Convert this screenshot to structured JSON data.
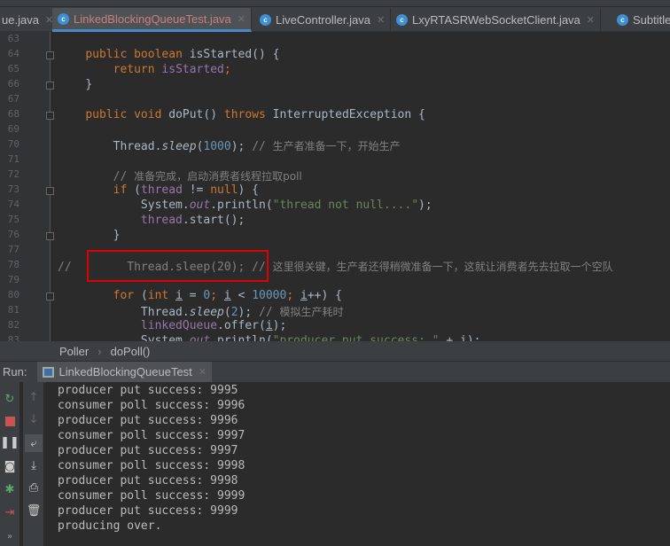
{
  "tabs": [
    {
      "label": "ue.java",
      "active": false
    },
    {
      "label": "LinkedBlockingQueueTest.java",
      "active": true
    },
    {
      "label": "LiveController.java",
      "active": false
    },
    {
      "label": "LxyRTASRWebSocketClient.java",
      "active": false
    },
    {
      "label": "SubtitleUti",
      "active": false
    }
  ],
  "editor": {
    "lines": [
      {
        "num": "63",
        "indent": "",
        "tokens": []
      },
      {
        "num": "64",
        "indent": "    ",
        "tokens": [
          {
            "t": "public ",
            "c": "kw"
          },
          {
            "t": "boolean ",
            "c": "kw"
          },
          {
            "t": "isStarted() {",
            "c": ""
          }
        ]
      },
      {
        "num": "65",
        "indent": "        ",
        "tokens": [
          {
            "t": "return ",
            "c": "kw"
          },
          {
            "t": "isStarted",
            "c": "fld"
          },
          {
            "t": ";",
            "c": "kw"
          }
        ]
      },
      {
        "num": "66",
        "indent": "    ",
        "tokens": [
          {
            "t": "}",
            "c": ""
          }
        ]
      },
      {
        "num": "67",
        "indent": "",
        "tokens": []
      },
      {
        "num": "68",
        "indent": "    ",
        "tokens": [
          {
            "t": "public ",
            "c": "kw"
          },
          {
            "t": "void ",
            "c": "kw"
          },
          {
            "t": "doPut() ",
            "c": ""
          },
          {
            "t": "throws ",
            "c": "kw"
          },
          {
            "t": "InterruptedException {",
            "c": ""
          }
        ]
      },
      {
        "num": "69",
        "indent": "",
        "tokens": []
      },
      {
        "num": "70",
        "indent": "        ",
        "tokens": [
          {
            "t": "Thread.",
            "c": ""
          },
          {
            "t": "sleep",
            "c": "it"
          },
          {
            "t": "(",
            "c": ""
          },
          {
            "t": "1000",
            "c": "num"
          },
          {
            "t": "); ",
            "c": ""
          },
          {
            "t": "// ",
            "c": "cm"
          },
          {
            "t": "生产者准备一下，开始生产",
            "c": "cmc"
          }
        ]
      },
      {
        "num": "71",
        "indent": "",
        "tokens": []
      },
      {
        "num": "72",
        "indent": "        ",
        "tokens": [
          {
            "t": "// ",
            "c": "cm"
          },
          {
            "t": "准备完成，启动消费者线程拉取poll",
            "c": "cmc"
          }
        ]
      },
      {
        "num": "73",
        "indent": "        ",
        "tokens": [
          {
            "t": "if ",
            "c": "kw"
          },
          {
            "t": "(",
            "c": ""
          },
          {
            "t": "thread ",
            "c": "fld"
          },
          {
            "t": "!= ",
            "c": ""
          },
          {
            "t": "null",
            "c": "kw"
          },
          {
            "t": ") {",
            "c": ""
          }
        ]
      },
      {
        "num": "74",
        "indent": "            ",
        "tokens": [
          {
            "t": "System.",
            "c": ""
          },
          {
            "t": "out",
            "c": "itf"
          },
          {
            "t": ".println(",
            "c": ""
          },
          {
            "t": "\"thread not null....\"",
            "c": "str"
          },
          {
            "t": ");",
            "c": ""
          }
        ]
      },
      {
        "num": "75",
        "indent": "            ",
        "tokens": [
          {
            "t": "thread",
            "c": "fld"
          },
          {
            "t": ".start();",
            "c": ""
          }
        ]
      },
      {
        "num": "76",
        "indent": "        ",
        "tokens": [
          {
            "t": "}",
            "c": ""
          }
        ]
      },
      {
        "num": "77",
        "indent": "",
        "tokens": []
      },
      {
        "num": "78",
        "indent": "",
        "tokens": [
          {
            "t": "//        Thread.sleep(20); // ",
            "c": "cm"
          },
          {
            "t": "这里很关键，生产者还得稍微准备一下，这就让消费者先去拉取一个空队",
            "c": "cmc"
          }
        ]
      },
      {
        "num": "79",
        "indent": "",
        "tokens": []
      },
      {
        "num": "80",
        "indent": "        ",
        "tokens": [
          {
            "t": "for ",
            "c": "kw"
          },
          {
            "t": "(",
            "c": ""
          },
          {
            "t": "int ",
            "c": "kw"
          },
          {
            "t": "i",
            "c": "u"
          },
          {
            "t": " = ",
            "c": ""
          },
          {
            "t": "0",
            "c": "num"
          },
          {
            "t": "; ",
            "c": "kw"
          },
          {
            "t": "i",
            "c": "u"
          },
          {
            "t": " < ",
            "c": ""
          },
          {
            "t": "10000",
            "c": "num"
          },
          {
            "t": "; ",
            "c": "kw"
          },
          {
            "t": "i",
            "c": "u"
          },
          {
            "t": "++) {",
            "c": ""
          }
        ]
      },
      {
        "num": "81",
        "indent": "            ",
        "tokens": [
          {
            "t": "Thread.",
            "c": ""
          },
          {
            "t": "sleep",
            "c": "it"
          },
          {
            "t": "(",
            "c": ""
          },
          {
            "t": "2",
            "c": "num"
          },
          {
            "t": "); ",
            "c": ""
          },
          {
            "t": "// ",
            "c": "cm"
          },
          {
            "t": "模拟生产耗时",
            "c": "cmc"
          }
        ]
      },
      {
        "num": "82",
        "indent": "            ",
        "tokens": [
          {
            "t": "linkedQueue",
            "c": "fld"
          },
          {
            "t": ".offer(",
            "c": ""
          },
          {
            "t": "i",
            "c": "u"
          },
          {
            "t": ");",
            "c": ""
          }
        ]
      },
      {
        "num": "83",
        "indent": "            ",
        "tokens": [
          {
            "t": "System.",
            "c": ""
          },
          {
            "t": "out",
            "c": "itf"
          },
          {
            "t": ".println(",
            "c": ""
          },
          {
            "t": "\"producer put success: \"",
            "c": "str"
          },
          {
            "t": " + ",
            "c": ""
          },
          {
            "t": "i",
            "c": "u"
          },
          {
            "t": ");",
            "c": ""
          }
        ]
      }
    ]
  },
  "breadcrumb": [
    "Poller",
    "doPoll()"
  ],
  "run": {
    "label": "Run:",
    "tab": "LinkedBlockingQueueTest"
  },
  "console": [
    "producer put success: 9995",
    "consumer poll success: 9996",
    "producer put success: 9996",
    "consumer poll success: 9997",
    "producer put success: 9997",
    "consumer poll success: 9998",
    "producer put success: 9998",
    "consumer poll success: 9999",
    "producer put success: 9999",
    "producing over."
  ],
  "colors": {
    "accent": "#4a88c7",
    "highlight": "#e00000"
  }
}
